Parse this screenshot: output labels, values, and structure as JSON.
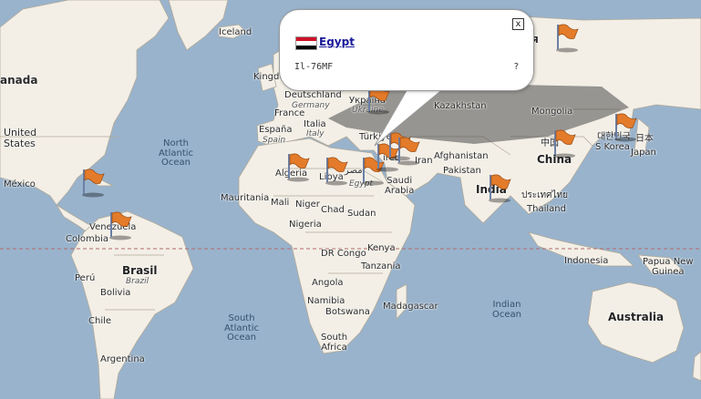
{
  "popup": {
    "close_label": "x",
    "country": "Egypt",
    "aircraft": "Il-76MF",
    "extra": "?",
    "flag_colors": [
      "#ce1126",
      "#ffffff",
      "#000000"
    ]
  },
  "map": {
    "colors": {
      "ocean": "#99b3cc",
      "land": "#f3efe6",
      "border": "#b0a99a",
      "equator": "#b26a6a"
    },
    "flag_icon": "orange-flag-marker-icon",
    "labels": {
      "iceland": "Iceland",
      "canada": "anada",
      "united_states": "United\nStates",
      "mexico": "México",
      "north_atlantic": "North\nAtlantic\nOcean",
      "venezuela": "Venezuela",
      "colombia": "Colombia",
      "peru": "Perú",
      "bolivia": "Bolivia",
      "brasil": "Brasil",
      "brazil": "Brazil",
      "chile": "Chile",
      "argentina": "Argentina",
      "south_atlantic": "South\nAtlantic\nOcean",
      "kingdom": "Kingdo",
      "deutschland": "Deutschland",
      "germany": "Germany",
      "france": "France",
      "espana": "España",
      "spain": "Spain",
      "italia": "Italia",
      "italy": "Italy",
      "turkiye": "Türkiye",
      "ukraina": "Україна",
      "ukraine": "Ukraine",
      "kazakhstan": "Kazakhstan",
      "mongolia": "Mongolia",
      "afghanistan": "Afghanistan",
      "pakistan": "Pakistan",
      "iran": "Iran",
      "india": "India",
      "china_zh": "中国",
      "china": "China",
      "thailand_th": "ประเทศไทย",
      "thailand": "Thailand",
      "s_korea_ko": "대한민국",
      "s_korea": "S Korea",
      "japan_jp": "日本",
      "japan": "Japan",
      "russia_frag": "Я",
      "algeria": "Algeria",
      "libya": "Libya",
      "egypt_ar": "مصر",
      "egypt": "Egypt",
      "saudi_arabia": "Saudi\nArabia",
      "mauritania": "Mauritania",
      "mali": "Mali",
      "niger": "Niger",
      "chad": "Chad",
      "sudan": "Sudan",
      "nigeria": "Nigeria",
      "dr_congo": "DR Congo",
      "kenya": "Kenya",
      "tanzania": "Tanzania",
      "angola": "Angola",
      "namibia": "Namibia",
      "botswana": "Botswana",
      "south_africa": "South\nAfrica",
      "madagascar": "Madagascar",
      "indian_ocean": "Indian\nOcean",
      "indonesia": "Indonesia",
      "papua_new_guinea": "Papua New\nGuinea",
      "australia": "Australia",
      "ired": "ired"
    }
  }
}
